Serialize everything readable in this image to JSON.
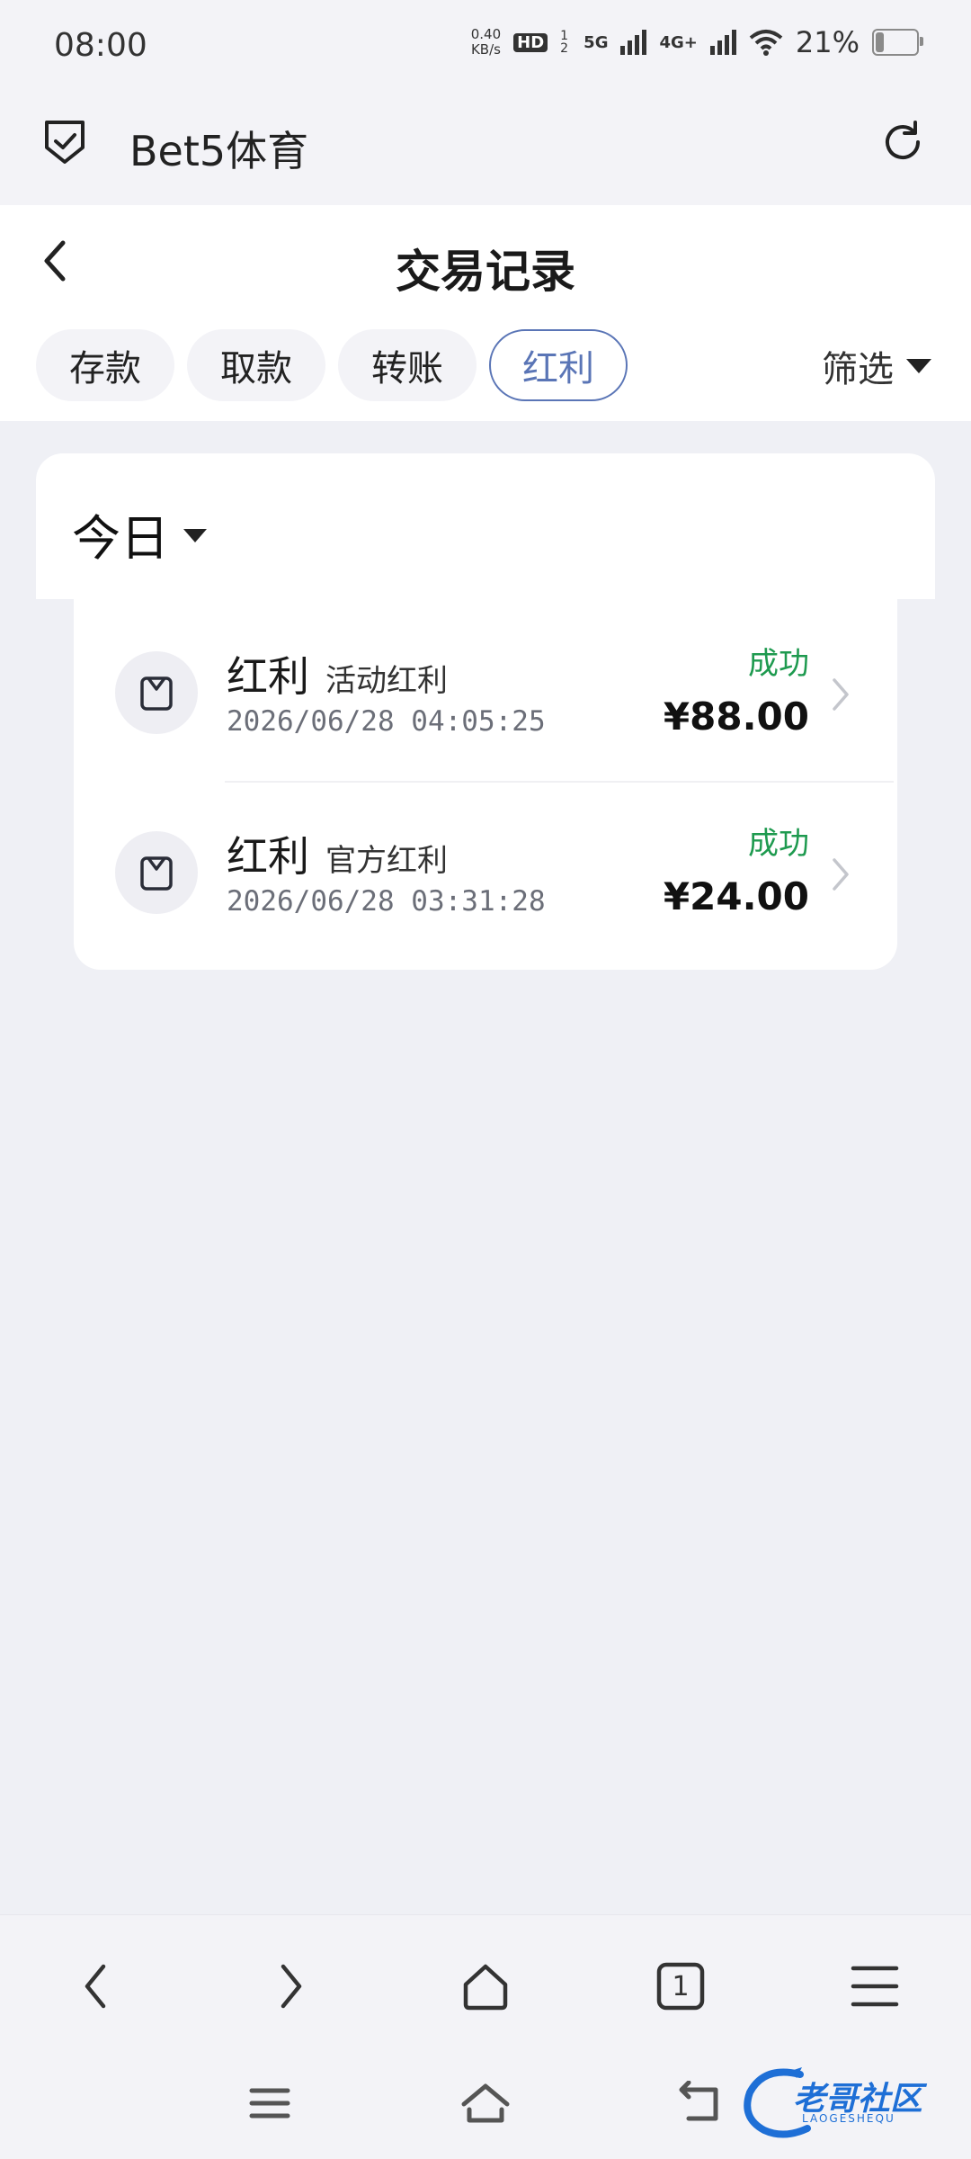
{
  "status_bar": {
    "time": "08:00",
    "net_speed_value": "0.40",
    "net_speed_unit": "KB/s",
    "hd_badge": "HD",
    "sim_slots": "1 2",
    "network_5g": "5G",
    "network_4g": "4G+",
    "battery_percent": "21%",
    "battery_level": 0.21
  },
  "browser": {
    "site_title": "Bet5体育"
  },
  "page": {
    "title": "交易记录",
    "tabs": [
      {
        "label": "存款",
        "active": false
      },
      {
        "label": "取款",
        "active": false
      },
      {
        "label": "转账",
        "active": false
      },
      {
        "label": "红利",
        "active": true
      }
    ],
    "filter_label": "筛选",
    "date_range": "今日"
  },
  "records": [
    {
      "type": "红利",
      "subtype": "活动红利",
      "datetime": "2026/06/28 04:05:25",
      "status": "成功",
      "amount": "¥88.00"
    },
    {
      "type": "红利",
      "subtype": "官方红利",
      "datetime": "2026/06/28 03:31:28",
      "status": "成功",
      "amount": "¥24.00"
    }
  ],
  "toolbar": {
    "tab_count": "1"
  },
  "watermark": {
    "text": "老哥社区",
    "subtext": "LAOGESHEQU"
  },
  "colors": {
    "accent": "#5a75b6",
    "success": "#1e9a4f",
    "background": "#eff0f5"
  },
  "icons": [
    "shield-check-icon",
    "reload-icon",
    "back-chevron-icon",
    "caret-down-icon",
    "wallet-icon",
    "chevron-right-icon",
    "menu-icon",
    "home-icon",
    "tabs-icon"
  ]
}
